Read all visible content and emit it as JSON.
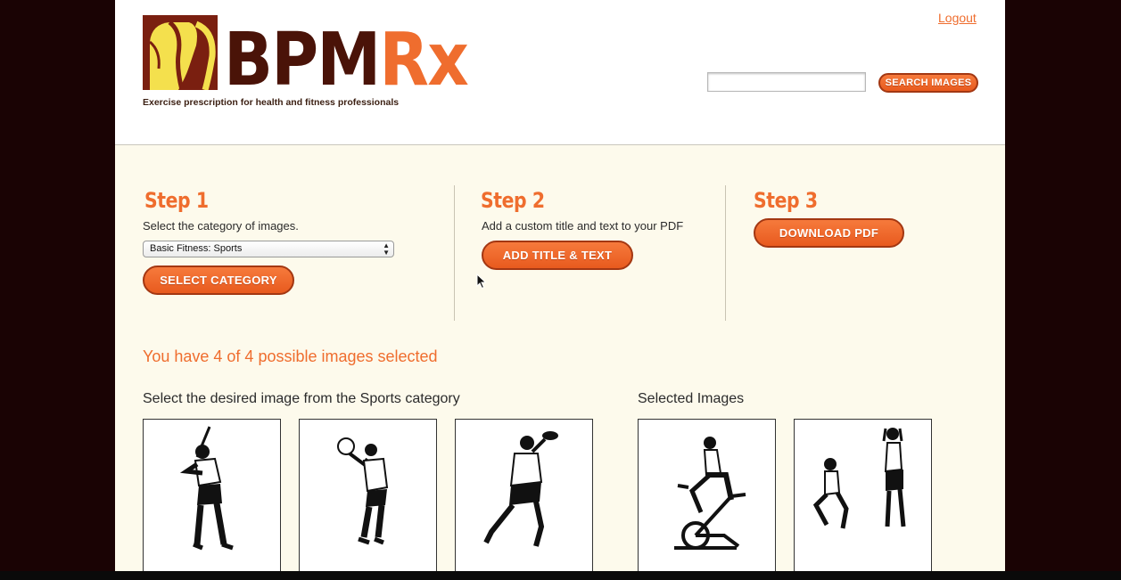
{
  "header": {
    "logo": {
      "word_dark": "BPM",
      "word_accent": "Rx"
    },
    "tagline": "Exercise prescription for health and fitness professionals",
    "logout_label": "Logout",
    "search": {
      "placeholder": "",
      "value": "",
      "button_label": "SEARCH IMAGES"
    }
  },
  "steps": [
    {
      "heading": "Step 1",
      "description": "Select the category of images.",
      "category_select": {
        "selected": "Basic Fitness: Sports"
      },
      "button_label": "SELECT CATEGORY"
    },
    {
      "heading": "Step 2",
      "description": "Add a custom title and text to your PDF",
      "button_label": "ADD TITLE & TEXT"
    },
    {
      "heading": "Step 3",
      "button_label": "DOWNLOAD PDF"
    }
  ],
  "selection_status": "You have 4 of 4 possible images selected",
  "available_images": {
    "title": "Select the desired image from the Sports category",
    "items": [
      {
        "icon": "baseball-batter-figure"
      },
      {
        "icon": "basketball-shooter-figure"
      },
      {
        "icon": "football-thrower-figure"
      }
    ]
  },
  "selected_images": {
    "title": "Selected Images",
    "items": [
      {
        "icon": "stationary-bike-rider-figure"
      },
      {
        "icon": "squat-and-stand-figures"
      }
    ]
  },
  "colors": {
    "accent": "#ef6d2e",
    "brand_dark": "#4a1308",
    "page_background": "#fdfaec",
    "outer_background": "#1a0304"
  }
}
